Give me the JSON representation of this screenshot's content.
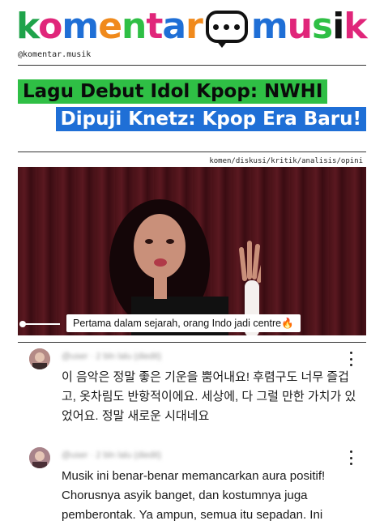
{
  "logo": {
    "text_before": "komentar",
    "text_after": "musik",
    "icon": "speech-bubble-icon",
    "letter_colors": [
      "#1fa34a",
      "#e0267a",
      "#1f6fd6",
      "#f08a1c",
      "#2fbf45",
      "#e0267a",
      "#1f6fd6",
      "#f08a1c"
    ],
    "letter_colors_after": [
      "#1f6fd6",
      "#e0267a",
      "#2fbf45",
      "#111111",
      "#e0267a"
    ]
  },
  "handle": "@komentar.musik",
  "headline": {
    "line1": "Lagu Debut Idol Kpop: NWHI",
    "line2": "Dipuji Knetz: Kpop Era Baru!",
    "line1_bg": "#2fbf45",
    "line2_bg": "#1f6fd6"
  },
  "tags": "komen/diskusi/kritik/analisis/opini",
  "video": {
    "caption": "Pertama dalam sejarah, orang Indo jadi centre🔥"
  },
  "comments": [
    {
      "meta": "@user · 2 bln lalu (diedit)",
      "text": "이 음악은 정말 좋은 기운을 뿜어내요! 후렴구도 너무 즐겁고, 옷차림도 반항적이에요. 세상에, 다 그럴 만한 가치가 있었어요. 정말 새로운 시대네요"
    },
    {
      "meta": "@user · 2 bln lalu (diedit)",
      "text": "Musik ini benar-benar memancarkan aura positif! Chorusnya asyik banget, dan kostumnya juga pemberontak. Ya ampun, semua itu sepadan. Ini"
    }
  ]
}
